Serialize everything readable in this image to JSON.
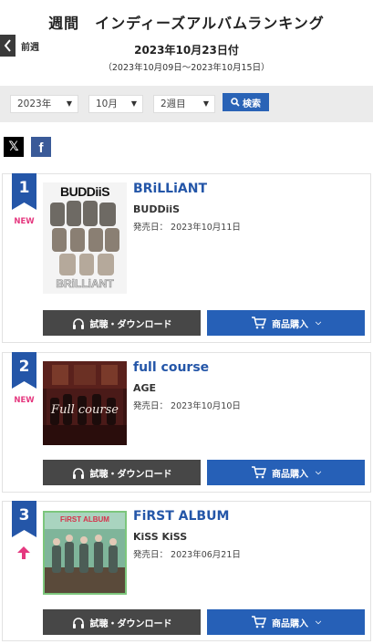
{
  "header": {
    "title": "週間　インディーズアルバムランキング",
    "prev_label": "前週",
    "date": "2023年10月23日付",
    "range": "（2023年10月09日〜2023年10月15日）"
  },
  "filters": {
    "year": "2023年",
    "month": "10月",
    "week": "2週目",
    "search_label": "検索"
  },
  "share": {
    "x_label": "𝕏",
    "fb_label": "f"
  },
  "buttons": {
    "listen": "試聴・ダウンロード",
    "buy": "商品購入"
  },
  "release_prefix": "発売日：",
  "rankings": [
    {
      "rank": "1",
      "badge": "NEW",
      "title": "BRiLLiANT",
      "artist": "BUDDiiS",
      "release_date": "2023年10月11日",
      "cover_text_top": "BUDDiiS",
      "cover_text_bottom": "BRiLLiANT"
    },
    {
      "rank": "2",
      "badge": "NEW",
      "title": "full course",
      "artist": "AGE",
      "release_date": "2023年10月10日",
      "cover_text": "Full course"
    },
    {
      "rank": "3",
      "badge": "up",
      "title": "FiRST ALBUM",
      "artist": "KiSS KiSS",
      "release_date": "2023年06月21日",
      "cover_text": "FiRST ALBUM"
    }
  ],
  "colors": {
    "accent_blue": "#2456a8",
    "new_pink": "#e5387f",
    "listen_gray": "#474747"
  }
}
